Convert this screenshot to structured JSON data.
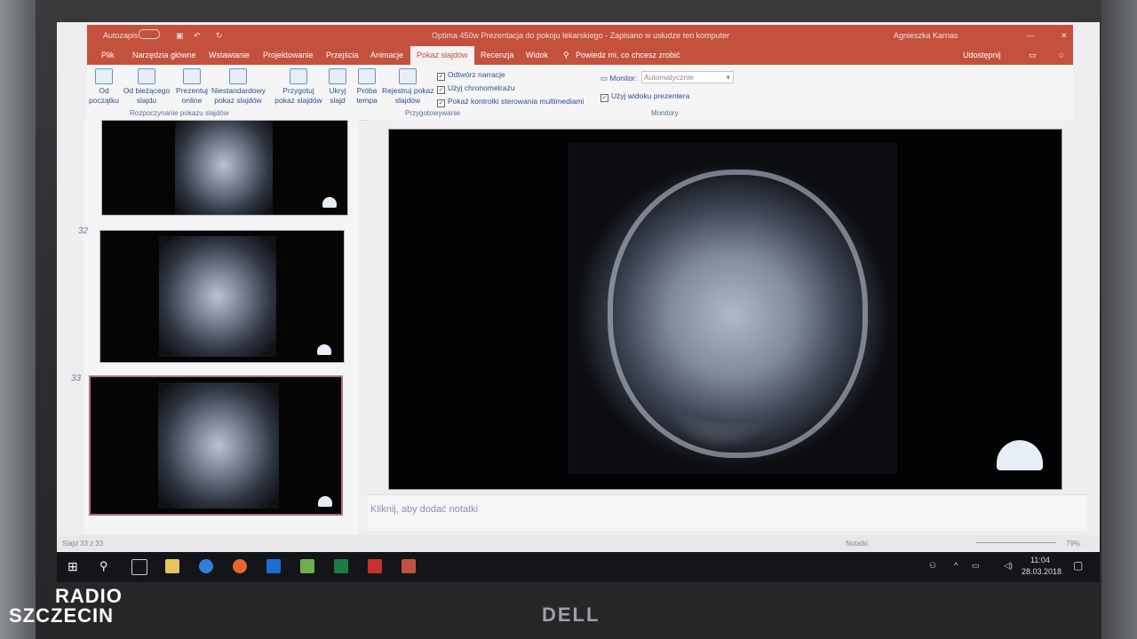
{
  "window": {
    "autosave": "Autozapis",
    "title": "Optima 450w Prezentacja do pokoju lekarskiego  -  Zapisano w usłudze ten komputer",
    "user": "Agnieszka Karnas"
  },
  "tabs": [
    "Plik",
    "Narzędzia główne",
    "Wstawianie",
    "Projektowanie",
    "Przejścia",
    "Animacje",
    "Pokaz slajdów",
    "Recenzja",
    "Widok"
  ],
  "tell_me": "Powiedz mi, co chcesz zrobić",
  "share": "Udostępnij",
  "ribbon": {
    "start_group": {
      "label": "Rozpoczynanie pokazu slajdów",
      "buttons": [
        {
          "line1": "Od",
          "line2": "początku"
        },
        {
          "line1": "Od bieżącego",
          "line2": "slajdu"
        },
        {
          "line1": "Prezentuj",
          "line2": "online"
        },
        {
          "line1": "Niestandardowy",
          "line2": "pokaz slajdów"
        }
      ]
    },
    "setup_group": {
      "label": "Przygotowywanie",
      "buttons": [
        {
          "line1": "Przygotuj",
          "line2": "pokaz slajdów"
        },
        {
          "line1": "Ukryj",
          "line2": "slajd"
        },
        {
          "line1": "Próba",
          "line2": "tempa"
        },
        {
          "line1": "Rejestruj pokaz",
          "line2": "slajdów"
        }
      ],
      "checks": [
        "Odtwórz narracje",
        "Użyj chronometrażu",
        "Pokaż kontrolki sterowania multimediami"
      ]
    },
    "monitors_group": {
      "label": "Monitory",
      "monitor_label": "Monitor:",
      "monitor_value": "Automatycznie",
      "presenter_view": "Użyj widoku prezentera"
    }
  },
  "slides": [
    {
      "num": "",
      "selected": false
    },
    {
      "num": "32",
      "selected": false
    },
    {
      "num": "33",
      "selected": true
    }
  ],
  "notes_placeholder": "Kliknij, aby dodać notatki",
  "status": {
    "slide_info": "Slajd 33 z 33",
    "notes_label": "Notatki",
    "zoom": "79%"
  },
  "taskbar": {
    "time": "11:04",
    "date": "28.03.2018"
  },
  "overlay": {
    "brand_top": "RADIO",
    "brand_bottom": "SZCZECIN",
    "laptop_logo": "DELL"
  }
}
